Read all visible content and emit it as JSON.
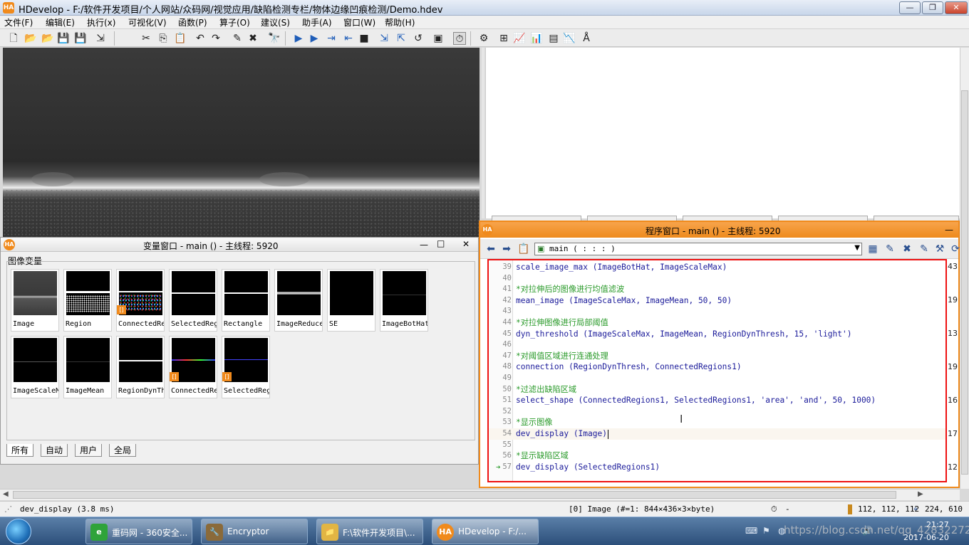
{
  "window": {
    "logo": "HA",
    "title": "HDevelop - F:/软件开发项目/个人网站/众码网/视觉应用/缺陷检测专栏/物体边缘凹痕检测/Demo.hdev",
    "min": "—",
    "max": "❐",
    "close": "✕"
  },
  "menu": [
    "文件(F)",
    "编辑(E)",
    "执行(x)",
    "可视化(V)",
    "函数(P)",
    "算子(O)",
    "建议(S)",
    "助手(A)",
    "窗口(W)",
    "帮助(H)"
  ],
  "variable_window": {
    "title": "变量窗口 - main () - 主线程: 5920",
    "minimize": "—",
    "maximize": "□",
    "close": "✕",
    "group_label": "图像变量",
    "row1": [
      "Image",
      "Region",
      "ConnectedRe",
      "SelectedReg",
      "Rectangle",
      "ImageReduce",
      "SE",
      "ImageBotHat"
    ],
    "row2": [
      "ImageScaleM",
      "ImageMean",
      "RegionDynTh",
      "ConnectedRe",
      "SelectedReg"
    ],
    "badge": "[]",
    "tabs": [
      "所有",
      "自动",
      "用户",
      "全局"
    ]
  },
  "program_window": {
    "title": "程序窗口 - main () - 主线程: 5920",
    "close": "—",
    "procedure": "main ( : : : )",
    "lines": [
      {
        "n": "39",
        "text": "scale_image_max (ImageBotHat, ImageScaleMax)",
        "comment": false
      },
      {
        "n": "40",
        "text": "",
        "comment": false
      },
      {
        "n": "41",
        "text": "*对拉伸后的图像进行均值滤波",
        "comment": true
      },
      {
        "n": "42",
        "text": "mean_image (ImageScaleMax, ImageMean, 50, 50)",
        "comment": false
      },
      {
        "n": "43",
        "text": "",
        "comment": false
      },
      {
        "n": "44",
        "text": "*对拉伸图像进行局部阈值",
        "comment": true
      },
      {
        "n": "45",
        "text": "dyn_threshold (ImageScaleMax, ImageMean, RegionDynThresh, 15, 'light')",
        "comment": false
      },
      {
        "n": "46",
        "text": "",
        "comment": false
      },
      {
        "n": "47",
        "text": "*对阈值区域进行连通处理",
        "comment": true
      },
      {
        "n": "48",
        "text": "connection (RegionDynThresh, ConnectedRegions1)",
        "comment": false
      },
      {
        "n": "49",
        "text": "",
        "comment": false
      },
      {
        "n": "50",
        "text": "*过滤出缺陷区域",
        "comment": true
      },
      {
        "n": "51",
        "text": "select_shape (ConnectedRegions1, SelectedRegions1, 'area', 'and', 50, 1000)",
        "comment": false
      },
      {
        "n": "52",
        "text": "",
        "comment": false
      },
      {
        "n": "53",
        "text": "*显示图像",
        "comment": true
      },
      {
        "n": "54",
        "text": "dev_display (Image)",
        "comment": false
      },
      {
        "n": "55",
        "text": "",
        "comment": false
      },
      {
        "n": "56",
        "text": "*显示缺陷区域",
        "comment": true
      },
      {
        "n": "57",
        "text": "dev_display (SelectedRegions1)",
        "comment": false
      }
    ]
  },
  "right_numbers": [
    "43",
    "19",
    "13",
    "19",
    "16",
    "17",
    "12"
  ],
  "status": {
    "op": "dev_display (3.8 ms)",
    "image_info": "[0] Image (#=1: 844×436×3×byte)",
    "timer": "-",
    "gray": "112, 112, 112",
    "coords": "224,  610"
  },
  "taskbar": {
    "items": [
      {
        "icon": "e",
        "label": "重码网 - 360安全..."
      },
      {
        "icon": "🔧",
        "label": "Encryptor"
      },
      {
        "icon": "📁",
        "label": "F:\\软件开发项目\\..."
      },
      {
        "icon": "HA",
        "label": "HDevelop - F:/..."
      }
    ],
    "time": "21:27",
    "date": "2017-06-20",
    "watermark": "https://blog.csdn.net/qq_42832272"
  }
}
